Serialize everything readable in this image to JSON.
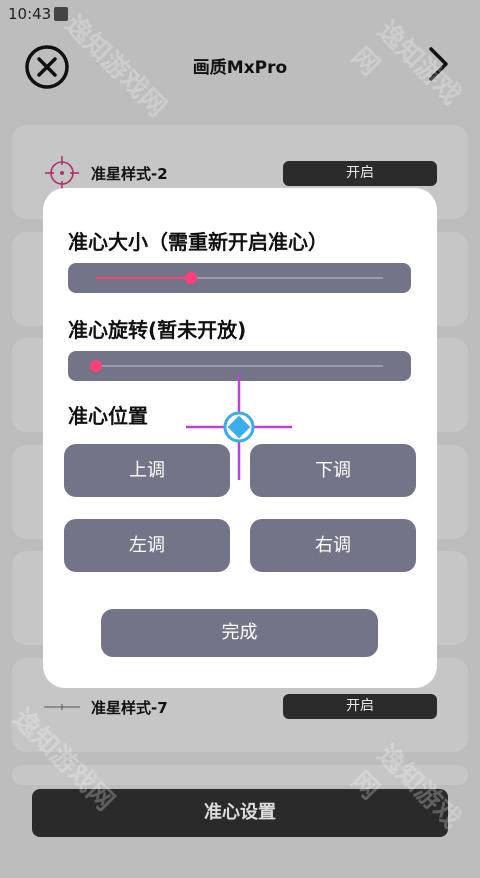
{
  "status_bar": {
    "time": "10:43"
  },
  "header": {
    "title": "画质MxPro"
  },
  "background_rows": [
    {
      "label": "准星样式-2",
      "toggle": "开启"
    },
    {
      "label": "准星样式-7",
      "toggle": "开启"
    }
  ],
  "bottom_bar": {
    "label": "准心设置"
  },
  "watermark": "逸知游戏网",
  "modal": {
    "size_title": "准心大小（需重新开启准心）",
    "size_value": 0.33,
    "rotation_title": "准心旋转(暂未开放)",
    "rotation_value": 0.0,
    "position_title": "准心位置",
    "buttons": {
      "up": "上调",
      "down": "下调",
      "left": "左调",
      "right": "右调"
    },
    "done": "完成"
  },
  "colors": {
    "accent": "#ff3f7a",
    "button": "#737488",
    "crosshair": "#bf40e0",
    "crosshair_center": "#3aaee8"
  },
  "icons": [
    "close-icon",
    "chevron-right-icon",
    "crosshair-icon"
  ]
}
